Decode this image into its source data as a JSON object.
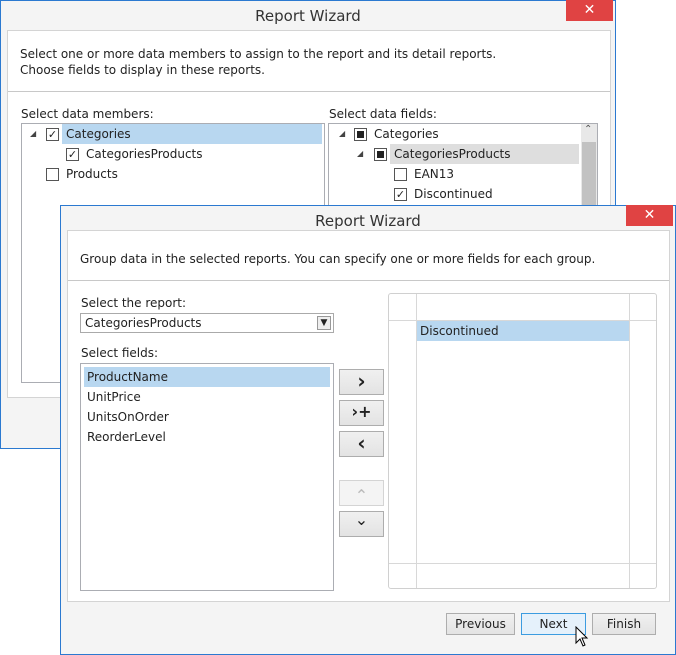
{
  "back": {
    "title": "Report Wizard",
    "close": "✕",
    "desc1": "Select one or more data members to assign to the report and its detail reports.",
    "desc2": "Choose fields to display in these reports.",
    "members_label": "Select data members:",
    "fields_label": "Select data fields:",
    "members": [
      "Categories",
      "CategoriesProducts",
      "Products"
    ],
    "fields": [
      "Categories",
      "CategoriesProducts",
      "EAN13",
      "Discontinued"
    ]
  },
  "front": {
    "title": "Report Wizard",
    "close": "✕",
    "desc": "Group data in the selected reports. You can specify one or more fields for each group.",
    "report_label": "Select the report:",
    "report_value": "CategoriesProducts",
    "fields_label": "Select fields:",
    "fields": [
      "ProductName",
      "UnitPrice",
      "UnitsOnOrder",
      "ReorderLevel"
    ],
    "groups": [
      "Discontinued"
    ],
    "buttons": {
      "add": "›",
      "add_nested": "›+",
      "remove": "‹",
      "up": "⌃",
      "down": "⌄",
      "previous": "Previous",
      "next": "Next",
      "finish": "Finish"
    }
  }
}
